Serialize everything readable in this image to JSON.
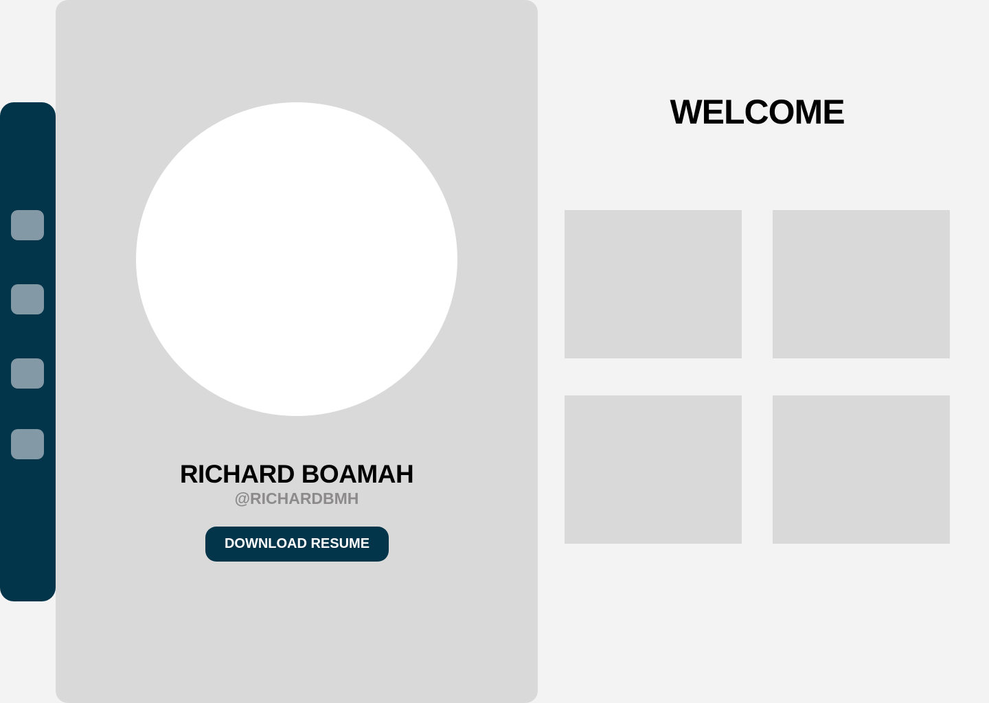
{
  "sidebar": {
    "items": [
      {
        "icon": "nav-icon-1"
      },
      {
        "icon": "nav-icon-2"
      },
      {
        "icon": "nav-icon-3"
      },
      {
        "icon": "nav-icon-4"
      }
    ]
  },
  "profile": {
    "name": "RICHARD BOAMAH",
    "handle": "@RICHARDBMH",
    "download_label": "DOWNLOAD RESUME"
  },
  "main": {
    "title": "WELCOME",
    "tiles": 4
  },
  "colors": {
    "accent": "#02344a",
    "nav_item": "#8399a5",
    "panel": "#d9d9d9",
    "background": "#f3f3f3"
  }
}
